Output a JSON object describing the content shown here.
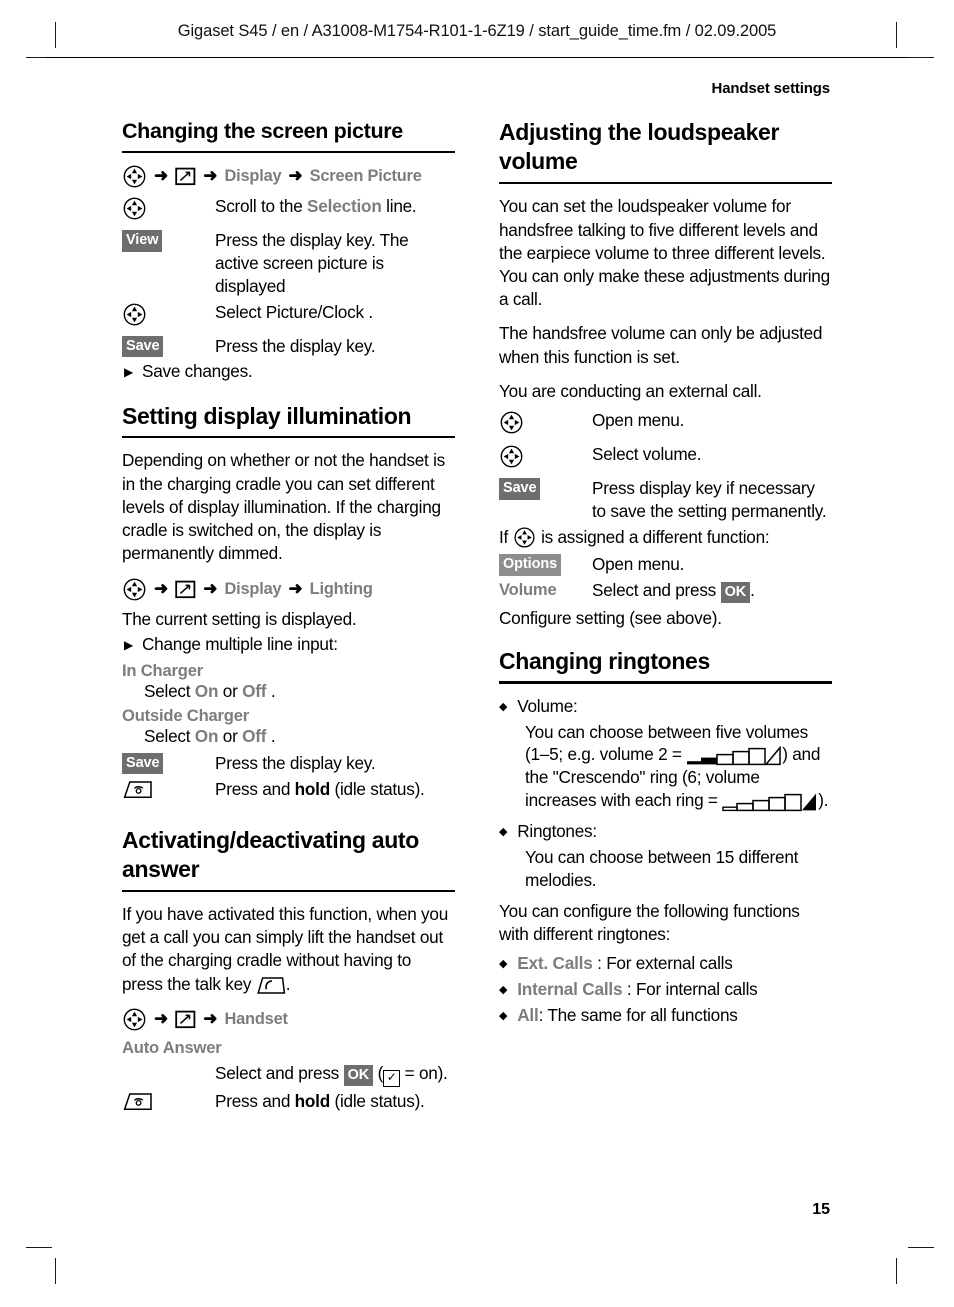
{
  "page": {
    "header_line": "Gigaset S45 / en / A31008-M1754-R101-1-6Z19 / start_guide_time.fm / 02.09.2005",
    "chapter": "Handset settings",
    "folio": "15"
  },
  "left_column": {
    "section1": {
      "title": "Changing the screen picture",
      "menu_path": [
        "Display",
        "Screen Picture"
      ],
      "steps": [
        {
          "key": "nav-key-icon",
          "text_parts": [
            "Scroll to the ",
            "Selection",
            " line."
          ]
        },
        {
          "key": "View",
          "key_type": "softkey",
          "text": "Press the display key. The active screen picture is displayed"
        },
        {
          "key": "nav-key-icon",
          "text": "Select Picture/Clock ."
        },
        {
          "key": "Save",
          "key_type": "softkey",
          "text": "Press the display key."
        }
      ],
      "final_step": "Save changes."
    },
    "section2": {
      "title": "Setting display illumination",
      "intro": "Depending on whether or not the handset is in the charging cradle you can set different levels of display illumination. If the charging cradle is switched on, the display is permanently dimmed.",
      "menu_path": [
        "Display",
        "Lighting"
      ],
      "note": "The current setting is displayed.",
      "bullet": "Change multiple line input:",
      "options": [
        {
          "label": "In Charger",
          "line_pre": "Select ",
          "on": "On",
          "mid": " or ",
          "off": "Off",
          "line_post": " ."
        },
        {
          "label": "Outside Charger",
          "line_pre": "Select ",
          "on": "On",
          "mid": " or ",
          "off": "Off",
          "line_post": " ."
        }
      ],
      "steps": [
        {
          "key": "Save",
          "key_type": "softkey",
          "text": "Press the display key."
        },
        {
          "key": "end-call-key-icon",
          "pre": "Press and ",
          "bold": "hold",
          "post": " (idle status)."
        }
      ]
    },
    "section3": {
      "title": "Activating/deactivating auto answer",
      "intro_pre": "If you have activated this function, when you get a call you can simply lift the handset out of the charging cradle without having to press the talk key ",
      "intro_post": ".",
      "menu_path": [
        "Handset"
      ],
      "option_label": "Auto Answer",
      "steps": [
        {
          "key": "",
          "pre": "Select and press ",
          "ok": "OK",
          "mid": " (",
          "checkbox": "✓",
          "post": " = on)."
        },
        {
          "key": "end-call-key-icon",
          "pre": "Press and ",
          "bold": "hold",
          "post": " (idle status)."
        }
      ]
    }
  },
  "right_column": {
    "section1": {
      "title": "Adjusting the loudspeaker volume",
      "para1": "You can set the loudspeaker volume for handsfree talking to five different levels and the earpiece volume to three different levels. You can only make these adjustments during a call.",
      "para2": "The handsfree volume can only be adjusted when this function is set.",
      "para3": "You are conducting an external call.",
      "steps": [
        {
          "key": "nav-key-icon",
          "text": "Open menu."
        },
        {
          "key": "nav-key-icon",
          "text": "Select volume."
        },
        {
          "key": "Save",
          "key_type": "softkey",
          "text": "Press display key if necessary to save the setting permanently."
        }
      ],
      "cond_pre": "If ",
      "cond_post": " is assigned a different function:",
      "steps2": [
        {
          "key": "Options",
          "key_type": "softkey-light",
          "text": "Open menu."
        },
        {
          "key": "Volume",
          "key_type": "grey-label",
          "pre": "Select and press ",
          "ok": "OK",
          "post": "."
        }
      ],
      "closing": "Configure setting (see above)."
    },
    "section2": {
      "title": "Changing ringtones",
      "bullets": [
        {
          "label": "Volume:",
          "body_a": "You can choose between five volumes (1–5; e.g. volume 2 = ",
          "body_b": ") and the \"Crescendo\" ring (6; volume increases with each ring = ",
          "body_c": ")."
        },
        {
          "label": "Ringtones:",
          "body": "You can choose between 15 different melodies."
        }
      ],
      "para": "You can configure the following functions with different ringtones:",
      "call_types": [
        {
          "label": "Ext. Calls",
          "sep": " : ",
          "desc": "For external calls"
        },
        {
          "label": "Internal Calls",
          "sep": " : ",
          "desc": "For internal calls"
        },
        {
          "label": "All",
          "sep": ": ",
          "desc": "The same for all functions"
        }
      ]
    }
  },
  "colors": {
    "menu_grey": "#7d7d7d",
    "softkey_bg": "#6e6e6e",
    "softkey_light_bg": "#8d8d8d",
    "rule": "#000000"
  }
}
